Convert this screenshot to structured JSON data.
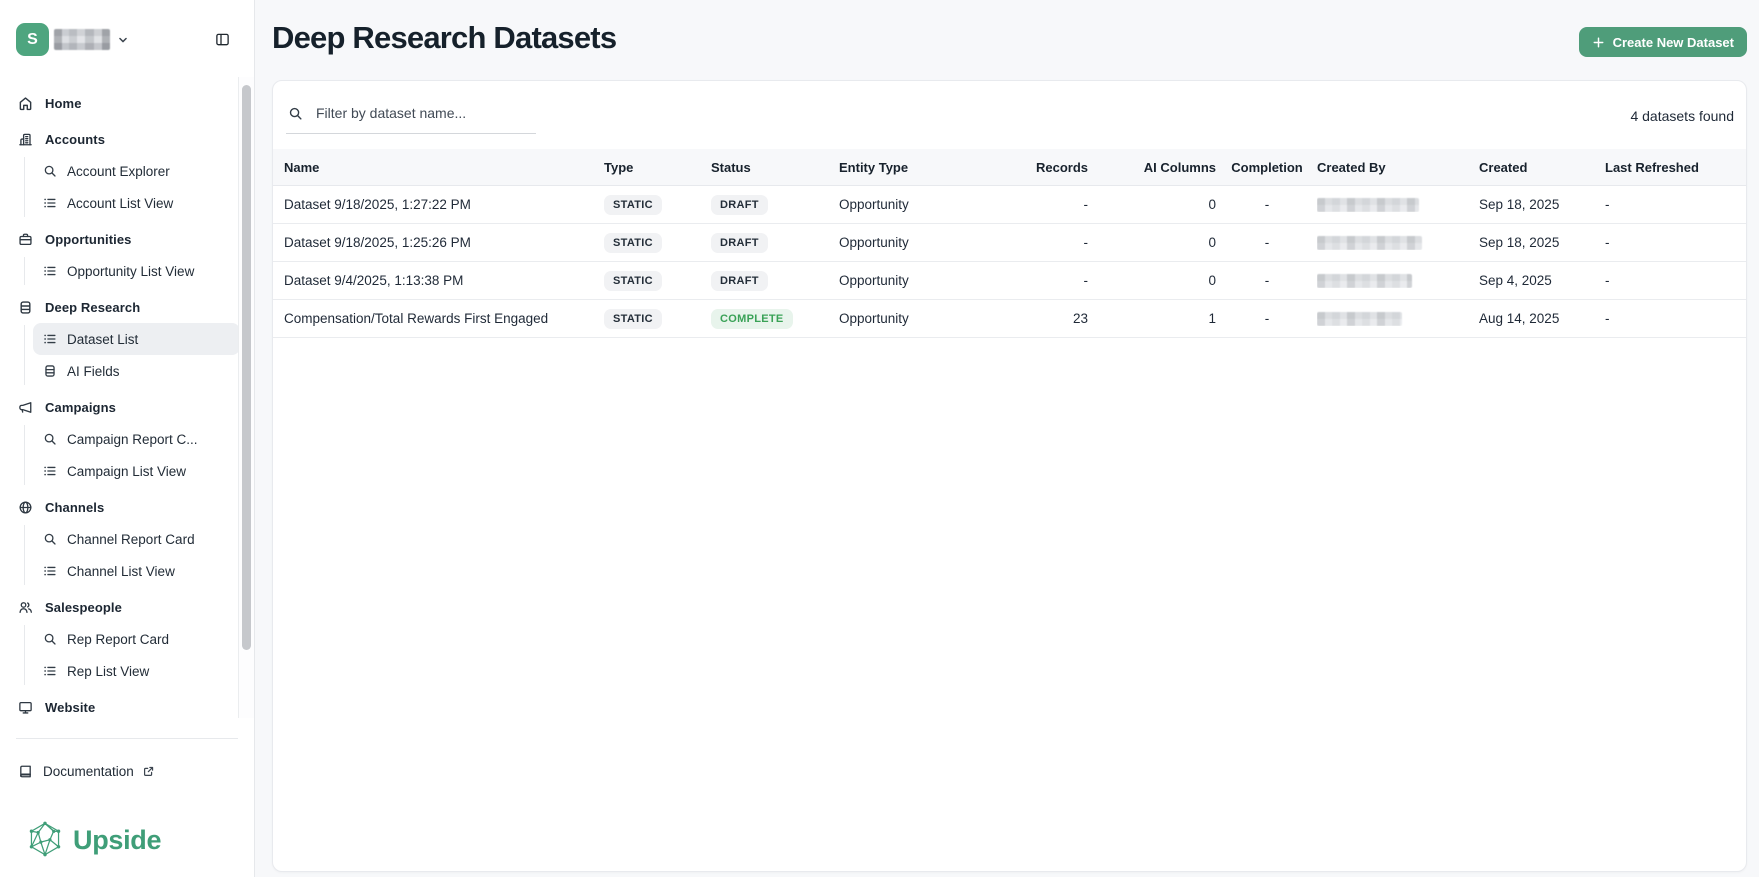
{
  "sidebar": {
    "workspace": {
      "initial": "S"
    },
    "nav": [
      {
        "label": "Home",
        "icon": "home"
      },
      {
        "label": "Accounts",
        "icon": "building",
        "children": [
          {
            "label": "Account Explorer",
            "icon": "search"
          },
          {
            "label": "Account List View",
            "icon": "list"
          }
        ]
      },
      {
        "label": "Opportunities",
        "icon": "briefcase",
        "children": [
          {
            "label": "Opportunity List View",
            "icon": "list"
          }
        ]
      },
      {
        "label": "Deep Research",
        "icon": "database",
        "children": [
          {
            "label": "Dataset List",
            "icon": "list",
            "selected": true
          },
          {
            "label": "AI Fields",
            "icon": "database"
          }
        ]
      },
      {
        "label": "Campaigns",
        "icon": "megaphone",
        "children": [
          {
            "label": "Campaign Report C...",
            "icon": "search"
          },
          {
            "label": "Campaign List View",
            "icon": "list"
          }
        ]
      },
      {
        "label": "Channels",
        "icon": "globe",
        "children": [
          {
            "label": "Channel Report Card",
            "icon": "search"
          },
          {
            "label": "Channel List View",
            "icon": "list"
          }
        ]
      },
      {
        "label": "Salespeople",
        "icon": "users",
        "children": [
          {
            "label": "Rep Report Card",
            "icon": "search"
          },
          {
            "label": "Rep List View",
            "icon": "list"
          }
        ]
      },
      {
        "label": "Website",
        "icon": "monitor"
      }
    ],
    "footer": {
      "documentation": "Documentation",
      "brand": "Upside"
    }
  },
  "header": {
    "title": "Deep Research Datasets",
    "create_button": "Create New Dataset"
  },
  "filters": {
    "placeholder": "Filter by dataset name...",
    "results": "4 datasets found"
  },
  "table": {
    "columns": [
      "Name",
      "Type",
      "Status",
      "Entity Type",
      "Records",
      "AI Columns",
      "Completion",
      "Created By",
      "Created",
      "Last Refreshed"
    ],
    "rows": [
      {
        "name": "Dataset 9/18/2025, 1:27:22 PM",
        "type": "STATIC",
        "status": "DRAFT",
        "entity_type": "Opportunity",
        "records": "-",
        "ai_columns": "0",
        "completion": "-",
        "created_by": "[redacted]",
        "created": "Sep 18, 2025",
        "last_refreshed": "-"
      },
      {
        "name": "Dataset 9/18/2025, 1:25:26 PM",
        "type": "STATIC",
        "status": "DRAFT",
        "entity_type": "Opportunity",
        "records": "-",
        "ai_columns": "0",
        "completion": "-",
        "created_by": "[redacted]",
        "created": "Sep 18, 2025",
        "last_refreshed": "-"
      },
      {
        "name": "Dataset 9/4/2025, 1:13:38 PM",
        "type": "STATIC",
        "status": "DRAFT",
        "entity_type": "Opportunity",
        "records": "-",
        "ai_columns": "0",
        "completion": "-",
        "created_by": "[redacted]",
        "created": "Sep 4, 2025",
        "last_refreshed": "-"
      },
      {
        "name": "Compensation/Total Rewards First Engaged",
        "type": "STATIC",
        "status": "COMPLETE",
        "entity_type": "Opportunity",
        "records": "23",
        "ai_columns": "1",
        "completion": "-",
        "created_by": "[redacted]",
        "created": "Aug 14, 2025",
        "last_refreshed": "-"
      }
    ]
  },
  "colors": {
    "brand_green": "#3f9e78",
    "button_green": "#4f9d7a",
    "logo_green": "#4ea57f",
    "badge_green_bg": "#e8f4ec",
    "badge_green_text": "#3aa257",
    "badge_gray_bg": "#f1f2f4"
  }
}
